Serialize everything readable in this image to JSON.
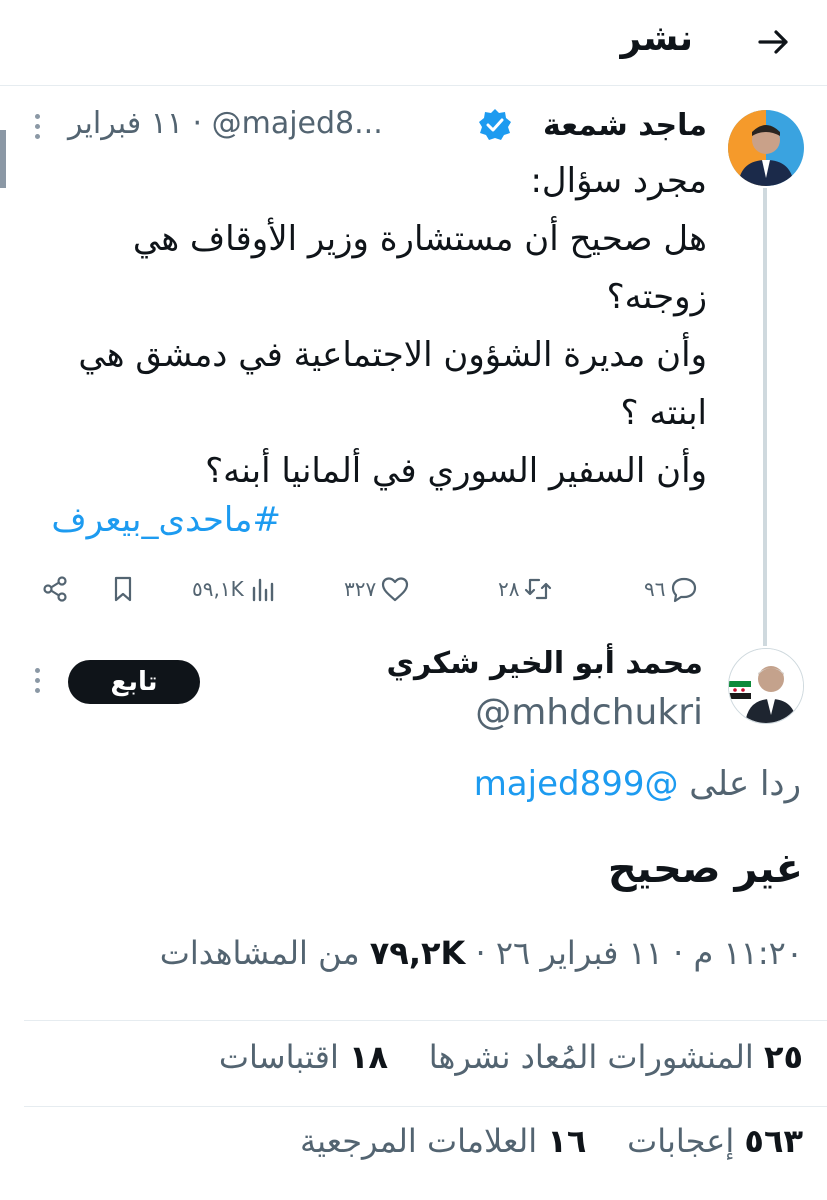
{
  "header": {
    "title": "نشر",
    "back_icon": "arrow-right-icon"
  },
  "parent_post": {
    "author_name": "ماجد شمعة",
    "verified_icon": "verified-badge-icon",
    "handle": "@majed8...",
    "time": "١١ فبراير",
    "separator": "·",
    "lines": [
      "مجرد سؤال:",
      "هل صحيح أن مستشارة وزير الأوقاف هي",
      "زوجته؟",
      "وأن مديرة الشؤون الاجتماعية في دمشق هي",
      "ابنته ؟",
      "وأن السفير السوري في ألمانيا أبنه؟"
    ],
    "hashtag": "#ماحدى_بيعرف",
    "actions": {
      "replies": "٩٦",
      "reposts": "٢٨",
      "likes": "٣٢٧",
      "views": "٥٩,١K"
    }
  },
  "reply_post": {
    "author_name": "محمد أبو الخير شكري",
    "handle": "@mhdchukri",
    "follow_label": "تابع",
    "reply_to_prefix": "ردا على",
    "reply_to_handle": "@majed899",
    "text": "غير صحيح",
    "timestamp_text": "١١:٢٠ م · ١١ فبراير ٢٦ · ",
    "views_count": "٧٩,٢K",
    "views_label": " من المشاهدات",
    "stats": {
      "reposts_count": "٢٥",
      "reposts_label": "المنشورات المُعاد نشرها",
      "quotes_count": "١٨",
      "quotes_label": "اقتباسات",
      "likes_count": "٥٦٣",
      "likes_label": "إعجابات",
      "bookmarks_count": "١٦",
      "bookmarks_label": "العلامات المرجعية"
    }
  },
  "colors": {
    "accent": "#1d9bf0",
    "text": "#0f1419",
    "muted": "#536471",
    "border": "#e6ecf0"
  }
}
